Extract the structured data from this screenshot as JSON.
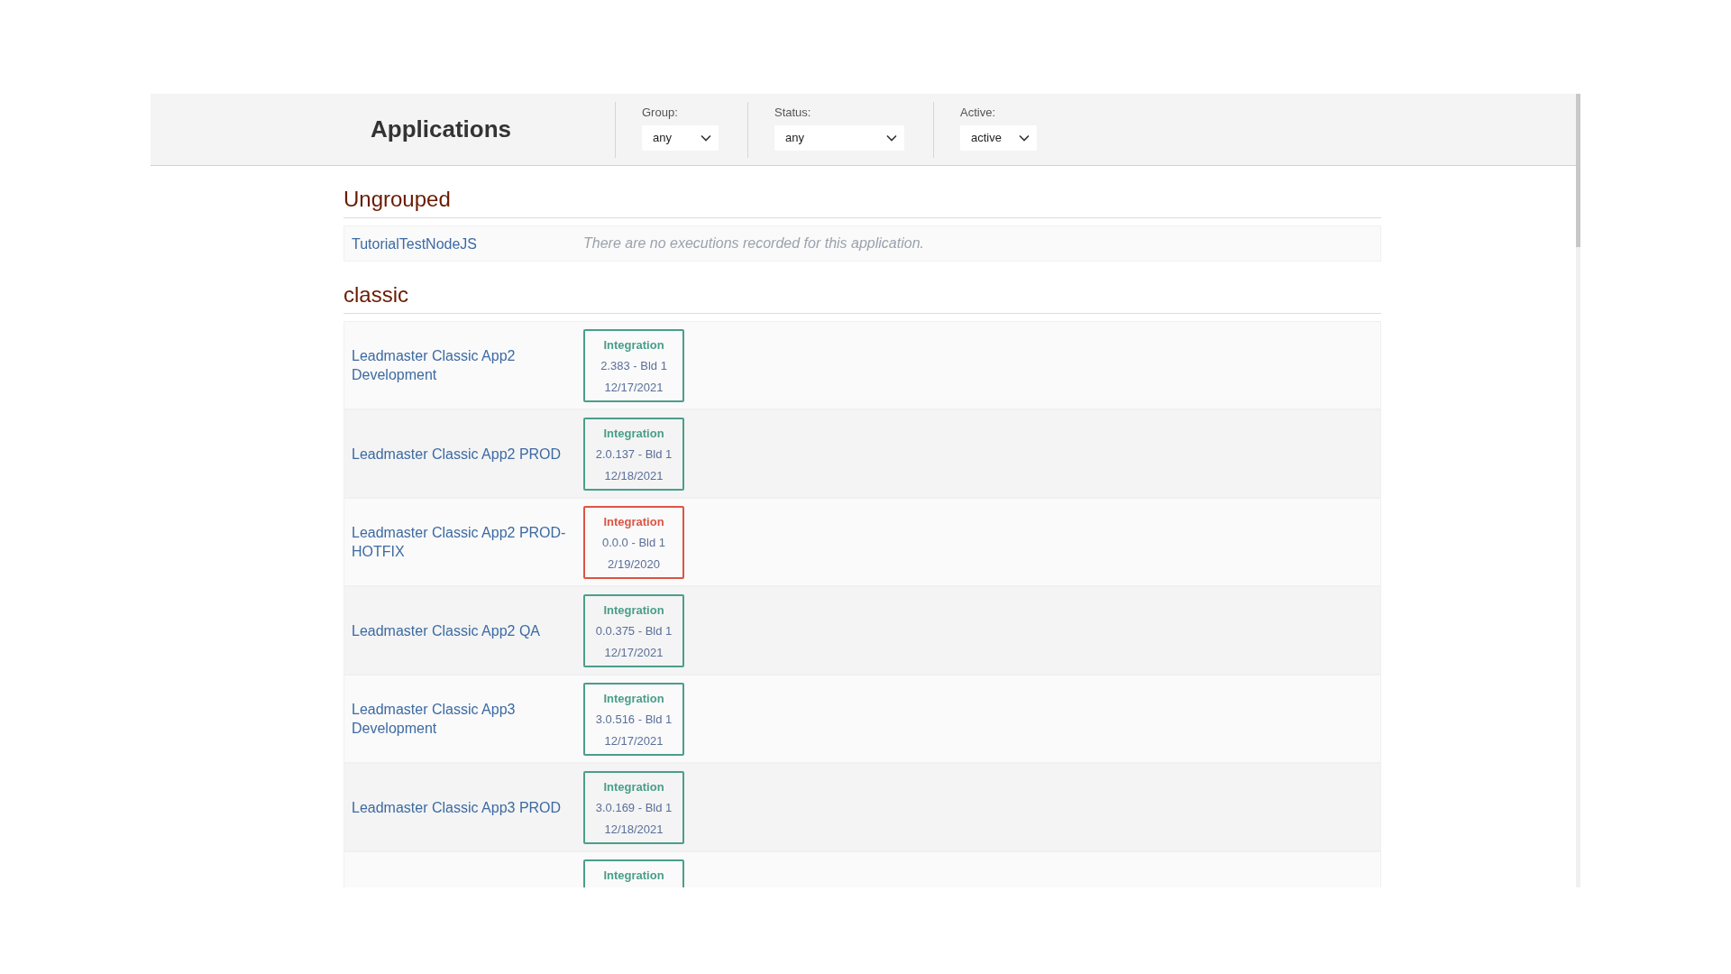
{
  "header": {
    "title": "Applications",
    "filters": [
      {
        "label": "Group:",
        "value": "any",
        "kind": "narrow"
      },
      {
        "label": "Status:",
        "value": "any",
        "kind": "wide"
      },
      {
        "label": "Active:",
        "value": "active",
        "kind": "narrow"
      }
    ]
  },
  "groups": [
    {
      "name": "Ungrouped",
      "applications": [
        {
          "name": "TutorialTestNodeJS",
          "message": "There are no executions recorded for this application."
        }
      ]
    },
    {
      "name": "classic",
      "applications": [
        {
          "name": "Leadmaster Classic App2 Development",
          "executions": [
            {
              "label": "Integration",
              "version": "2.383 - Bld 1",
              "date": "12/17/2021",
              "color": "#4a9e8a"
            }
          ]
        },
        {
          "name": "Leadmaster Classic App2 PROD",
          "executions": [
            {
              "label": "Integration",
              "version": "2.0.137 - Bld 1",
              "date": "12/18/2021",
              "color": "#4a9e8a"
            }
          ]
        },
        {
          "name": "Leadmaster Classic App2 PROD-HOTFIX",
          "executions": [
            {
              "label": "Integration",
              "version": "0.0.0 - Bld 1",
              "date": "2/19/2020",
              "color": "#dd5444"
            }
          ]
        },
        {
          "name": "Leadmaster Classic App2 QA",
          "executions": [
            {
              "label": "Integration",
              "version": "0.0.375 - Bld 1",
              "date": "12/17/2021",
              "color": "#4a9e8a"
            }
          ]
        },
        {
          "name": "Leadmaster Classic App3 Development",
          "executions": [
            {
              "label": "Integration",
              "version": "3.0.516 - Bld 1",
              "date": "12/17/2021",
              "color": "#4a9e8a"
            }
          ]
        },
        {
          "name": "Leadmaster Classic App3 PROD",
          "executions": [
            {
              "label": "Integration",
              "version": "3.0.169 - Bld 1",
              "date": "12/18/2021",
              "color": "#4a9e8a"
            }
          ]
        },
        {
          "executions": [
            {
              "label": "Integration",
              "color": "#4a9e8a"
            }
          ]
        }
      ]
    }
  ]
}
